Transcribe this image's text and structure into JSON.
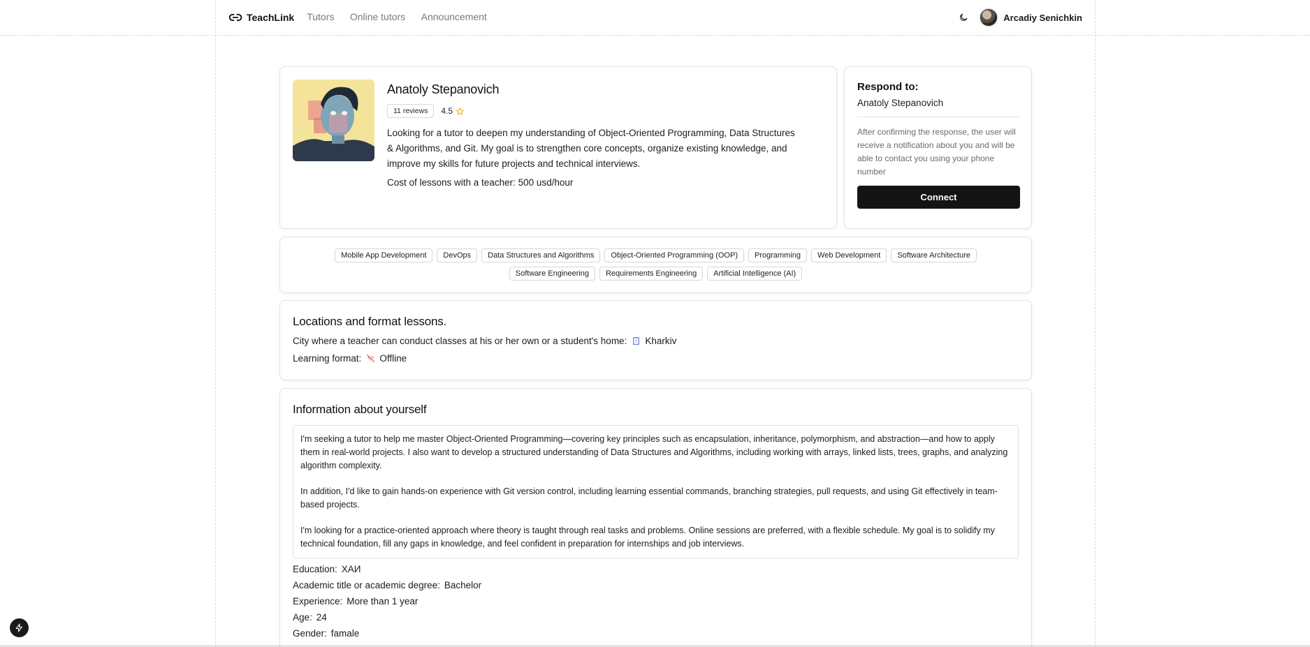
{
  "header": {
    "brand": "TeachLink",
    "nav": [
      "Tutors",
      "Online tutors",
      "Announcement"
    ],
    "user_name": "Arcadiy Senichkin",
    "theme_icon": "moon-icon"
  },
  "profile": {
    "name": "Anatoly Stepanovich",
    "reviews": "11 reviews",
    "rating": "4.5",
    "description": "Looking for a tutor to deepen my understanding of Object-Oriented Programming, Data Structures & Algorithms, and Git. My goal is to strengthen core concepts, organize existing knowledge, and improve my skills for future projects and technical interviews.",
    "cost": "Cost of lessons with a teacher: 500 usd/hour"
  },
  "respond": {
    "title": "Respond to:",
    "name": "Anatoly Stepanovich",
    "note": "After confirming the response, the user will receive a notification about you and will be able to contact you using your phone number",
    "button": "Connect"
  },
  "tags": [
    "Mobile App Development",
    "DevOps",
    "Data Structures and Algorithms",
    "Object-Oriented Programming (OOP)",
    "Programming",
    "Web Development",
    "Software Architecture",
    "Software Engineering",
    "Requirements Engineering",
    "Artificial Intelligence (AI)"
  ],
  "locations": {
    "title": "Locations and format lessons.",
    "city_label": "City where a teacher can conduct classes at his or her own or a student's home:",
    "city": "Kharkiv",
    "format_label": "Learning format:",
    "format": "Offline"
  },
  "info": {
    "title": "Information about yourself",
    "paragraphs": [
      "I'm seeking a tutor to help me master Object-Oriented Programming—covering key principles such as encapsulation, inheritance, polymorphism, and abstraction—and how to apply them in real-world projects. I also want to develop a structured understanding of Data Structures and Algorithms, including working with arrays, linked lists, trees, graphs, and analyzing algorithm complexity.",
      "In addition, I'd like to gain hands-on experience with Git version control, including learning essential commands, branching strategies, pull requests, and using Git effectively in team-based projects.",
      "I'm looking for a practice-oriented approach where theory is taught through real tasks and problems. Online sessions are preferred, with a flexible schedule. My goal is to solidify my technical foundation, fill any gaps in knowledge, and feel confident in preparation for internships and job interviews."
    ],
    "details": [
      {
        "label": "Education:",
        "value": "ХАИ"
      },
      {
        "label": "Academic title or academic degree:",
        "value": "Bachelor"
      },
      {
        "label": "Experience:",
        "value": "More than 1 year"
      },
      {
        "label": "Age:",
        "value": "24"
      },
      {
        "label": "Gender:",
        "value": "famale"
      }
    ]
  },
  "colors": {
    "accent": "#141414",
    "star": "#e6b800",
    "muted": "#7a7a80"
  }
}
